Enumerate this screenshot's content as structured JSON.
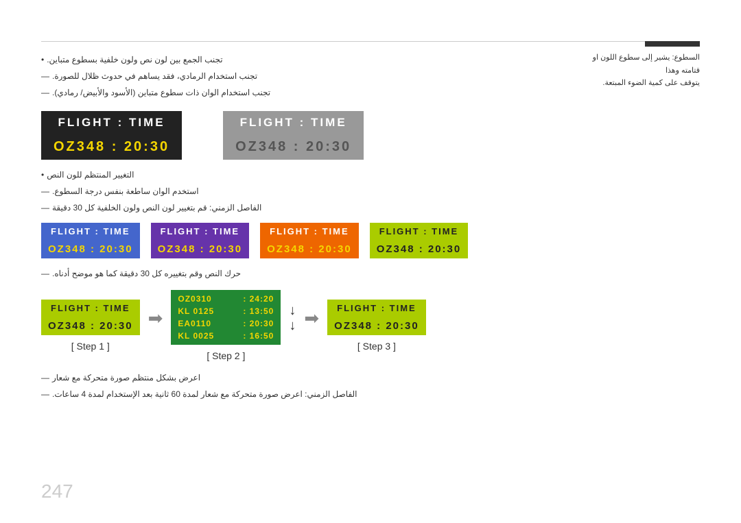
{
  "page": {
    "number": "247"
  },
  "top_note": {
    "line1": "السطوع: يشير إلى سطوع اللون او قتامته وهذا",
    "line2": "يتوقف على كمية الضوء المبتعة."
  },
  "section1": {
    "bullet1": "تجنب الجمع بين لون نص ولون خلفية بسطوع متباين.",
    "dash1": "تجنب استخدام الرمادي، فقد يساهم في حدوث ظلال للصورة.",
    "dash2": "تجنب استخدام الوان ذات سطوع متباين (الأسود والأبيض/ رمادي)."
  },
  "boards_large": {
    "board1": {
      "type": "black",
      "header": "FLIGHT  :  TIME",
      "data": "OZ348  :  20:30"
    },
    "board2": {
      "type": "gray",
      "header": "FLIGHT  :  TIME",
      "data": "OZ348  :  20:30"
    }
  },
  "section2": {
    "bullet1": "التغيير المنتظم للون النص",
    "dash1": "استخدم الوان ساطعة بنفس درجة السطوع.",
    "dash2": "الفاصل الزمني: قم بتغيير لون النص ولون الخلفية كل 30 دقيقة"
  },
  "boards_small": [
    {
      "type": "blue",
      "header": "FLIGHT  :  TIME",
      "data": "OZ348  :  20:30"
    },
    {
      "type": "purple",
      "header": "FLIGHT  :  TIME",
      "data": "OZ348  :  20:30"
    },
    {
      "type": "orange",
      "header": "FLIGHT  :  TIME",
      "data": "OZ348  :  20:30"
    },
    {
      "type": "green-yellow",
      "header": "FLIGHT  :  TIME",
      "data": "OZ348  :  20:30"
    }
  ],
  "section3": {
    "dash1": "حرك النص وقم بتغييره كل 30 دقيقة كما هو موضح أدناه."
  },
  "steps": {
    "step1": {
      "label": "[ Step 1 ]",
      "board_header": "FLIGHT  :  TIME",
      "board_data": "OZ348  :  20:30"
    },
    "step2": {
      "label": "[ Step 2 ]",
      "rows": [
        "OZ0310 :  24:20",
        "KL 0125 :  13:50",
        "EA0110 :  20:30",
        "KL 0025 :  16:50"
      ]
    },
    "step3": {
      "label": "[ Step 3 ]",
      "board_header": "FLIGHT  :  TIME",
      "board_data": "OZ348  :  20:30"
    }
  },
  "section4": {
    "dash1": "اعرض بشكل منتظم صورة متحركة مع شعار",
    "dash2": "الفاصل الزمني: اعرض صورة متحركة مع شعار لمدة 60 ثانية بعد الإستخدام لمدة 4 ساعات."
  }
}
